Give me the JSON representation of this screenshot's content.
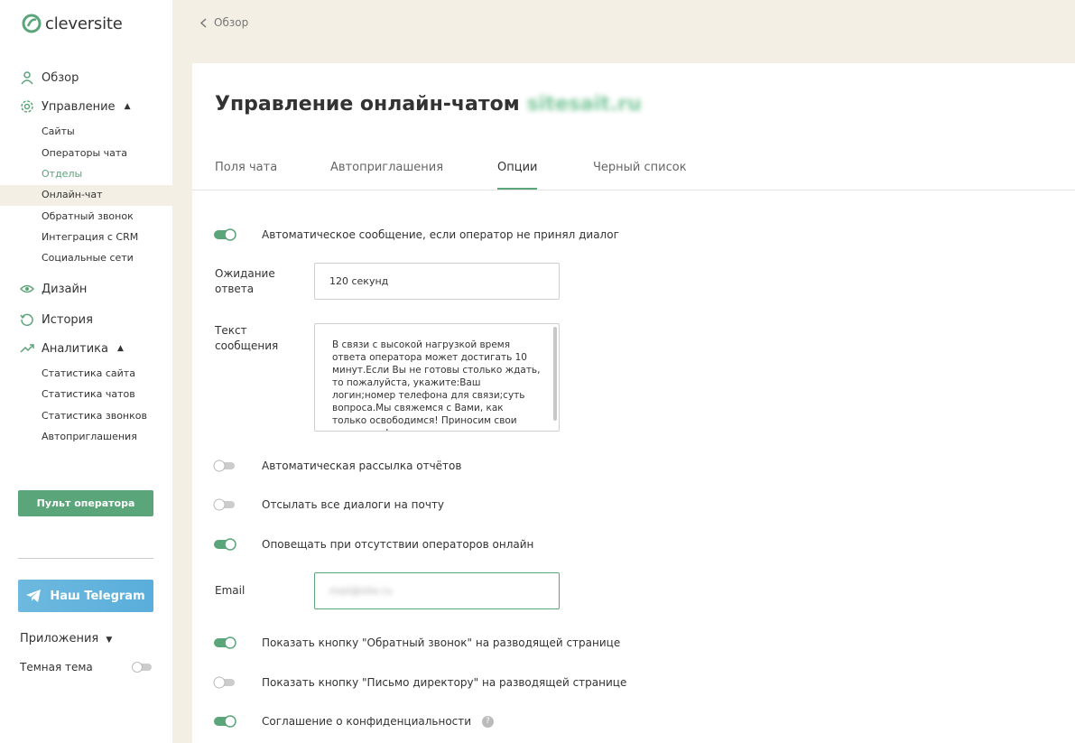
{
  "brand": {
    "name": "cleversite",
    "accent": "#5aa57a"
  },
  "sidebar": {
    "overview": "Обзор",
    "management": "Управление",
    "management_items": [
      "Сайты",
      "Операторы чата",
      "Отделы",
      "Онлайн-чат",
      "Обратный звонок",
      "Интеграция с CRM",
      "Социальные сети"
    ],
    "design": "Дизайн",
    "history": "История",
    "analytics": "Аналитика",
    "analytics_items": [
      "Статистика сайта",
      "Статистика чатов",
      "Статистика звонков",
      "Автоприглашения"
    ],
    "operator_button": "Пульт оператора",
    "telegram_button": "Наш Telegram",
    "apps": "Приложения",
    "dark_theme": "Темная тема"
  },
  "breadcrumb": {
    "back": "Обзор"
  },
  "main": {
    "title": "Управление онлайн-чатом",
    "site_blurred": "sitesait.ru",
    "tabs": [
      "Поля чата",
      "Автоприглашения",
      "Опции",
      "Черный список"
    ],
    "active_tab": "Опции",
    "options": {
      "auto_message": {
        "label": "Автоматическое сообщение, если оператор не принял диалог",
        "enabled": true
      },
      "wait_label": "Ожидание ответа",
      "wait_value": "120 секунд",
      "message_label": "Текст сообщения",
      "message_text": "В связи с высокой нагрузкой время ответа оператора может достигать 10 минут.Если Вы не готовы столько ждать, то пожалуйста, укажите:Ваш логин;номер телефона для связи;суть вопроса.Мы свяжемся с Вами, как только освободимся! Приносим свои извинения!",
      "auto_reports": {
        "label": "Автоматическая рассылка отчётов",
        "enabled": false
      },
      "send_dialogs": {
        "label": "Отсылать все диалоги на почту",
        "enabled": false
      },
      "notify_offline": {
        "label": "Оповещать при отсутствии операторов онлайн",
        "enabled": true
      },
      "email_label": "Email",
      "email_blurred": "mail@site.ru",
      "callback_button": {
        "label": "Показать кнопку \"Обратный звонок\" на разводящей странице",
        "enabled": true
      },
      "director_button": {
        "label": "Показать кнопку \"Письмо директору\" на разводящей странице",
        "enabled": false
      },
      "privacy": {
        "label": "Соглашение о конфиденциальности",
        "enabled": true
      }
    }
  }
}
